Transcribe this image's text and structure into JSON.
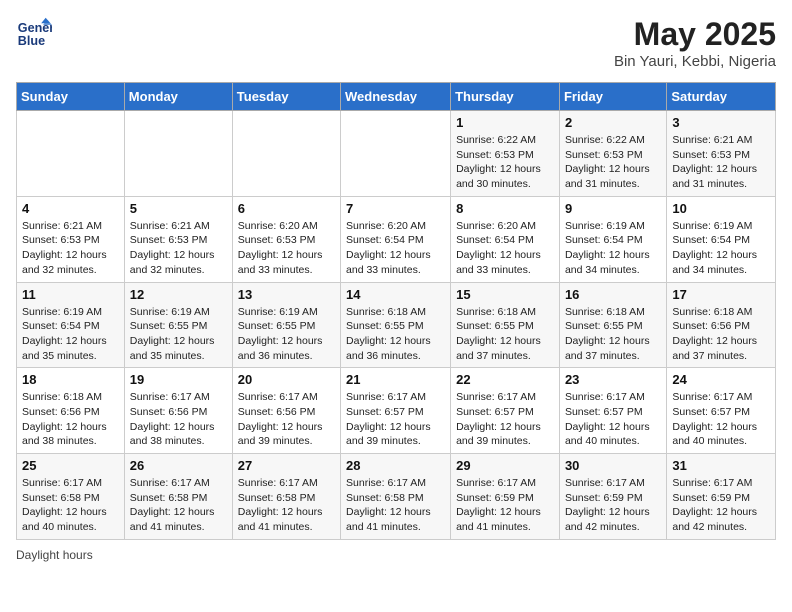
{
  "header": {
    "logo_line1": "General",
    "logo_line2": "Blue",
    "title": "May 2025",
    "subtitle": "Bin Yauri, Kebbi, Nigeria"
  },
  "columns": [
    "Sunday",
    "Monday",
    "Tuesday",
    "Wednesday",
    "Thursday",
    "Friday",
    "Saturday"
  ],
  "footer": "Daylight hours",
  "weeks": [
    [
      {
        "day": "",
        "info": ""
      },
      {
        "day": "",
        "info": ""
      },
      {
        "day": "",
        "info": ""
      },
      {
        "day": "",
        "info": ""
      },
      {
        "day": "1",
        "info": "Sunrise: 6:22 AM\nSunset: 6:53 PM\nDaylight: 12 hours and 30 minutes."
      },
      {
        "day": "2",
        "info": "Sunrise: 6:22 AM\nSunset: 6:53 PM\nDaylight: 12 hours and 31 minutes."
      },
      {
        "day": "3",
        "info": "Sunrise: 6:21 AM\nSunset: 6:53 PM\nDaylight: 12 hours and 31 minutes."
      }
    ],
    [
      {
        "day": "4",
        "info": "Sunrise: 6:21 AM\nSunset: 6:53 PM\nDaylight: 12 hours and 32 minutes."
      },
      {
        "day": "5",
        "info": "Sunrise: 6:21 AM\nSunset: 6:53 PM\nDaylight: 12 hours and 32 minutes."
      },
      {
        "day": "6",
        "info": "Sunrise: 6:20 AM\nSunset: 6:53 PM\nDaylight: 12 hours and 33 minutes."
      },
      {
        "day": "7",
        "info": "Sunrise: 6:20 AM\nSunset: 6:54 PM\nDaylight: 12 hours and 33 minutes."
      },
      {
        "day": "8",
        "info": "Sunrise: 6:20 AM\nSunset: 6:54 PM\nDaylight: 12 hours and 33 minutes."
      },
      {
        "day": "9",
        "info": "Sunrise: 6:19 AM\nSunset: 6:54 PM\nDaylight: 12 hours and 34 minutes."
      },
      {
        "day": "10",
        "info": "Sunrise: 6:19 AM\nSunset: 6:54 PM\nDaylight: 12 hours and 34 minutes."
      }
    ],
    [
      {
        "day": "11",
        "info": "Sunrise: 6:19 AM\nSunset: 6:54 PM\nDaylight: 12 hours and 35 minutes."
      },
      {
        "day": "12",
        "info": "Sunrise: 6:19 AM\nSunset: 6:55 PM\nDaylight: 12 hours and 35 minutes."
      },
      {
        "day": "13",
        "info": "Sunrise: 6:19 AM\nSunset: 6:55 PM\nDaylight: 12 hours and 36 minutes."
      },
      {
        "day": "14",
        "info": "Sunrise: 6:18 AM\nSunset: 6:55 PM\nDaylight: 12 hours and 36 minutes."
      },
      {
        "day": "15",
        "info": "Sunrise: 6:18 AM\nSunset: 6:55 PM\nDaylight: 12 hours and 37 minutes."
      },
      {
        "day": "16",
        "info": "Sunrise: 6:18 AM\nSunset: 6:55 PM\nDaylight: 12 hours and 37 minutes."
      },
      {
        "day": "17",
        "info": "Sunrise: 6:18 AM\nSunset: 6:56 PM\nDaylight: 12 hours and 37 minutes."
      }
    ],
    [
      {
        "day": "18",
        "info": "Sunrise: 6:18 AM\nSunset: 6:56 PM\nDaylight: 12 hours and 38 minutes."
      },
      {
        "day": "19",
        "info": "Sunrise: 6:17 AM\nSunset: 6:56 PM\nDaylight: 12 hours and 38 minutes."
      },
      {
        "day": "20",
        "info": "Sunrise: 6:17 AM\nSunset: 6:56 PM\nDaylight: 12 hours and 39 minutes."
      },
      {
        "day": "21",
        "info": "Sunrise: 6:17 AM\nSunset: 6:57 PM\nDaylight: 12 hours and 39 minutes."
      },
      {
        "day": "22",
        "info": "Sunrise: 6:17 AM\nSunset: 6:57 PM\nDaylight: 12 hours and 39 minutes."
      },
      {
        "day": "23",
        "info": "Sunrise: 6:17 AM\nSunset: 6:57 PM\nDaylight: 12 hours and 40 minutes."
      },
      {
        "day": "24",
        "info": "Sunrise: 6:17 AM\nSunset: 6:57 PM\nDaylight: 12 hours and 40 minutes."
      }
    ],
    [
      {
        "day": "25",
        "info": "Sunrise: 6:17 AM\nSunset: 6:58 PM\nDaylight: 12 hours and 40 minutes."
      },
      {
        "day": "26",
        "info": "Sunrise: 6:17 AM\nSunset: 6:58 PM\nDaylight: 12 hours and 41 minutes."
      },
      {
        "day": "27",
        "info": "Sunrise: 6:17 AM\nSunset: 6:58 PM\nDaylight: 12 hours and 41 minutes."
      },
      {
        "day": "28",
        "info": "Sunrise: 6:17 AM\nSunset: 6:58 PM\nDaylight: 12 hours and 41 minutes."
      },
      {
        "day": "29",
        "info": "Sunrise: 6:17 AM\nSunset: 6:59 PM\nDaylight: 12 hours and 41 minutes."
      },
      {
        "day": "30",
        "info": "Sunrise: 6:17 AM\nSunset: 6:59 PM\nDaylight: 12 hours and 42 minutes."
      },
      {
        "day": "31",
        "info": "Sunrise: 6:17 AM\nSunset: 6:59 PM\nDaylight: 12 hours and 42 minutes."
      }
    ]
  ]
}
